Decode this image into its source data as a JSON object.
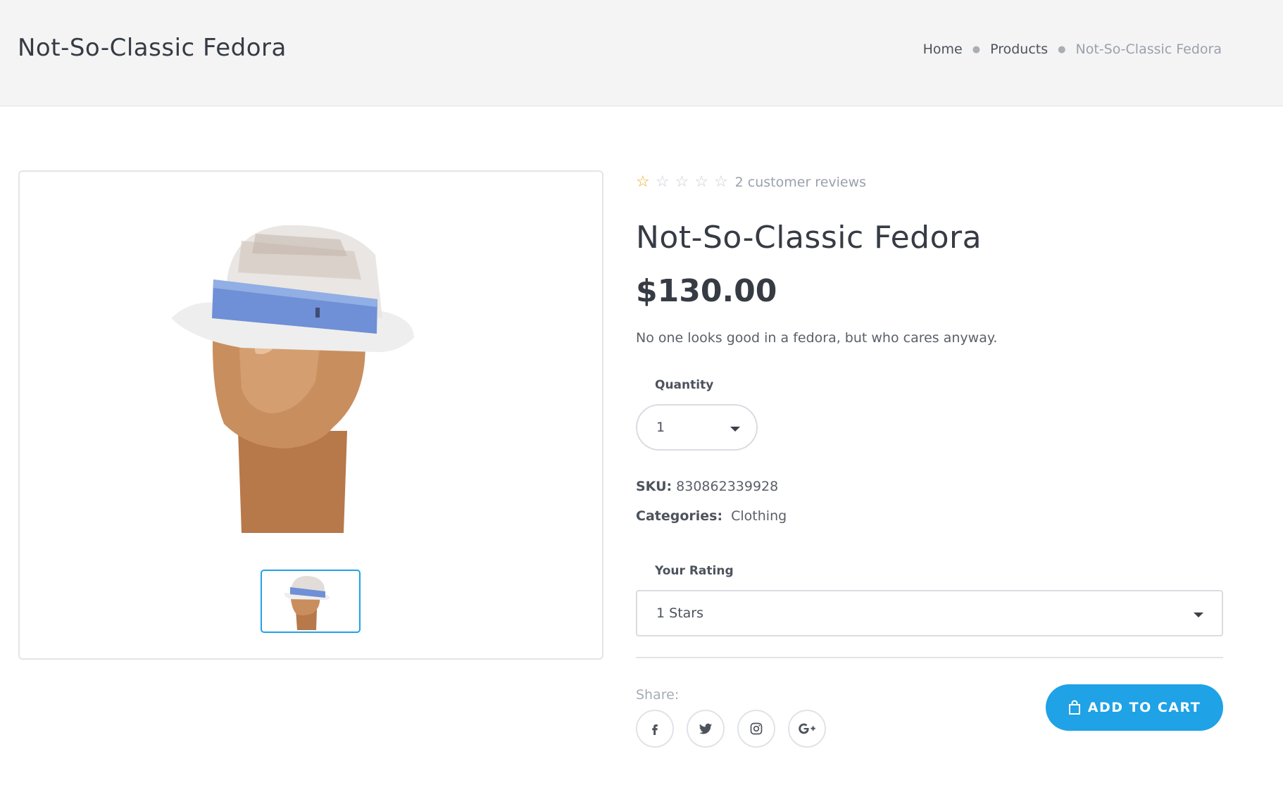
{
  "header": {
    "title": "Not-So-Classic Fedora",
    "breadcrumb": [
      "Home",
      "Products",
      "Not-So-Classic Fedora"
    ]
  },
  "product": {
    "rating": 1,
    "rating_max": 5,
    "reviews_text": "2 customer reviews",
    "title": "Not-So-Classic Fedora",
    "price": "$130.00",
    "description": "No one looks good in a fedora, but who cares anyway.",
    "quantity_label": "Quantity",
    "quantity_value": "1",
    "sku_label": "SKU",
    "sku_value": "830862339928",
    "categories_label": "Categories",
    "categories_value": "Clothing",
    "your_rating_label": "Your Rating",
    "your_rating_value": "1 Stars",
    "share_label": "Share:",
    "add_to_cart": "ADD TO CART"
  },
  "social": [
    "facebook-icon",
    "twitter-icon",
    "instagram-icon",
    "google-plus-icon"
  ],
  "colors": {
    "accent": "#1fa2e6",
    "star": "#f5a623",
    "header_bg": "#f4f4f4"
  }
}
